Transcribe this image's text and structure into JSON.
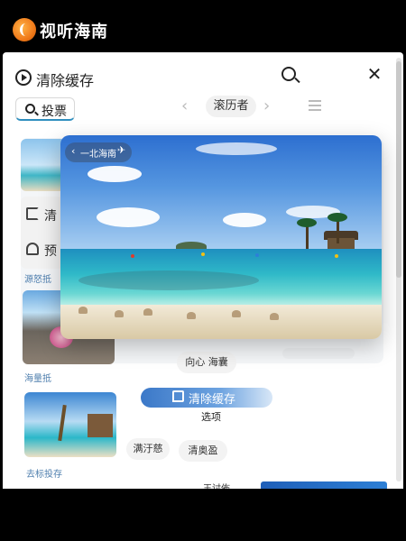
{
  "app": {
    "title": "视听海南",
    "logo": "app-logo-icon"
  },
  "panel": {
    "title": "清除缓存",
    "icons": {
      "clear": "clear-cache-icon",
      "search": "search-icon",
      "close": "close-icon"
    },
    "close_glyph": "✕"
  },
  "tabs": {
    "search_label": "投票",
    "left_arrow": "‹",
    "filter_label": "滚历者",
    "right_arrow": "›",
    "menu": "menu-icon"
  },
  "side_menu": {
    "item1": "清",
    "item2": "预"
  },
  "labels": {
    "thumb_a": "源怒抵",
    "thumb_b": "海量抵",
    "thumb_c": "去标投存"
  },
  "pills": {
    "a": "向心 海囊",
    "b": "满汙慈",
    "c": "清奥盈"
  },
  "actions": {
    "clear_button": "清除缓存",
    "option": "选项",
    "cut_text": "王讨佈"
  },
  "floating_window": {
    "back_glyph": "‹",
    "back_label": "一北海南",
    "plane_glyph": "✈"
  },
  "colors": {
    "accent": "#3b78c8",
    "label_blue": "#4f7fae",
    "background": "#000000"
  }
}
